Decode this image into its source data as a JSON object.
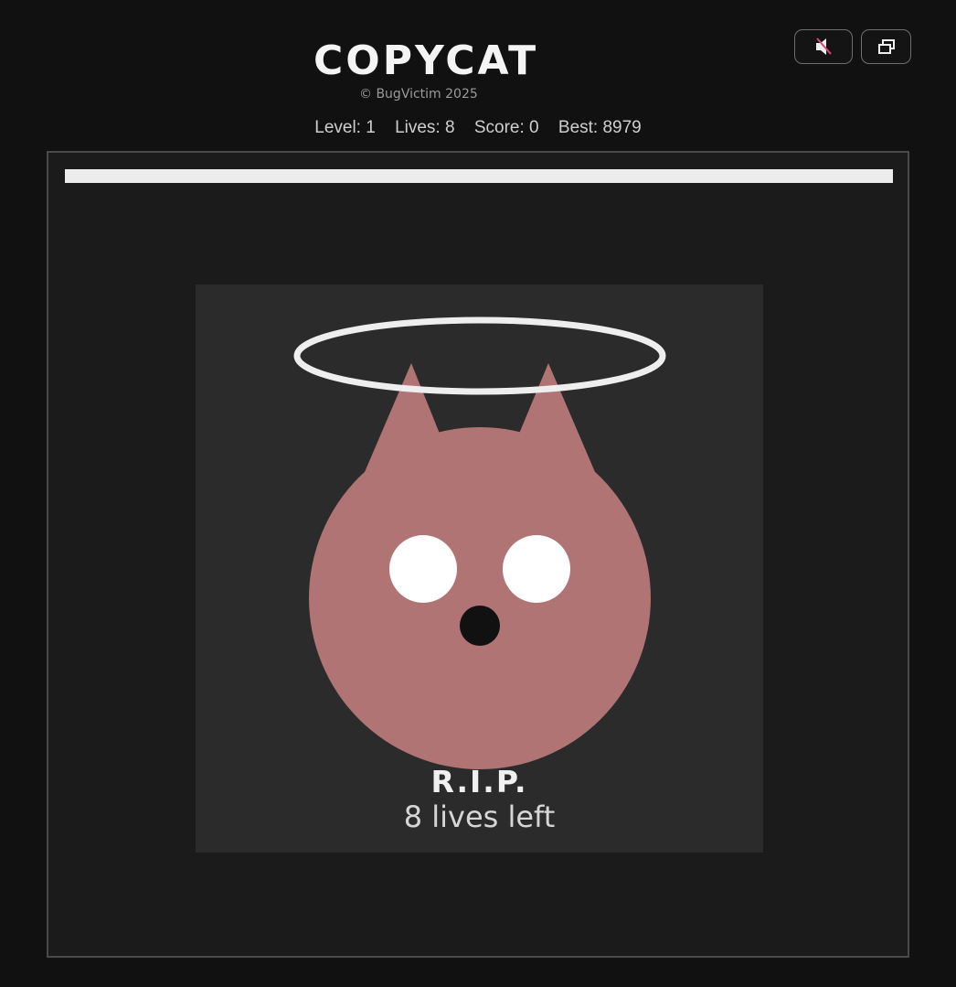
{
  "header": {
    "title": "COPYCAT",
    "copyright": "© BugVictim 2025"
  },
  "stats": {
    "level": "Level: 1",
    "lives": "Lives: 8",
    "score": "Score: 0",
    "best": "Best: 8979"
  },
  "toolbar": {
    "mute_icon": "speaker-muted-icon",
    "window_icon": "restore-window-icon"
  },
  "timer": {
    "remaining_fraction": 1.0
  },
  "death_screen": {
    "heading": "R.I.P.",
    "subtext": "8 lives left"
  },
  "colors": {
    "background": "#111111",
    "board": "#1b1b1b",
    "panel": "#2b2b2b",
    "cat_fur": "#b07474",
    "halo": "#eeeeee",
    "eyes": "#ffffff",
    "nose": "#111111",
    "mute_slash": "#e0457b"
  }
}
